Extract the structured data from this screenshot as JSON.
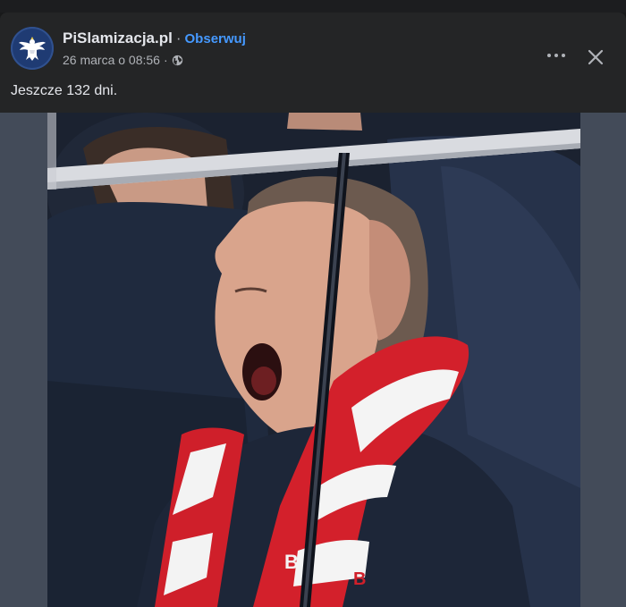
{
  "post": {
    "page_name": "PiSlamizacja.pl",
    "separator": "·",
    "follow_label": "Obserwuj",
    "timestamp": "26 marca o 08:56",
    "audience_icon": "globe-icon",
    "text": "Jeszcze 132 dni.",
    "more_icon": "more-horizontal-icon",
    "close_icon": "close-icon"
  },
  "photo": {
    "scarf_text_left": "B",
    "scarf_text_right": "B"
  },
  "colors": {
    "page_background": "#18191a",
    "card_background": "#242526",
    "media_backdrop": "#434b59",
    "primary_text": "#e4e6eb",
    "secondary_text": "#b0b3b8",
    "link_blue": "#4599ff",
    "avatar_blue": "#1f3b73"
  }
}
